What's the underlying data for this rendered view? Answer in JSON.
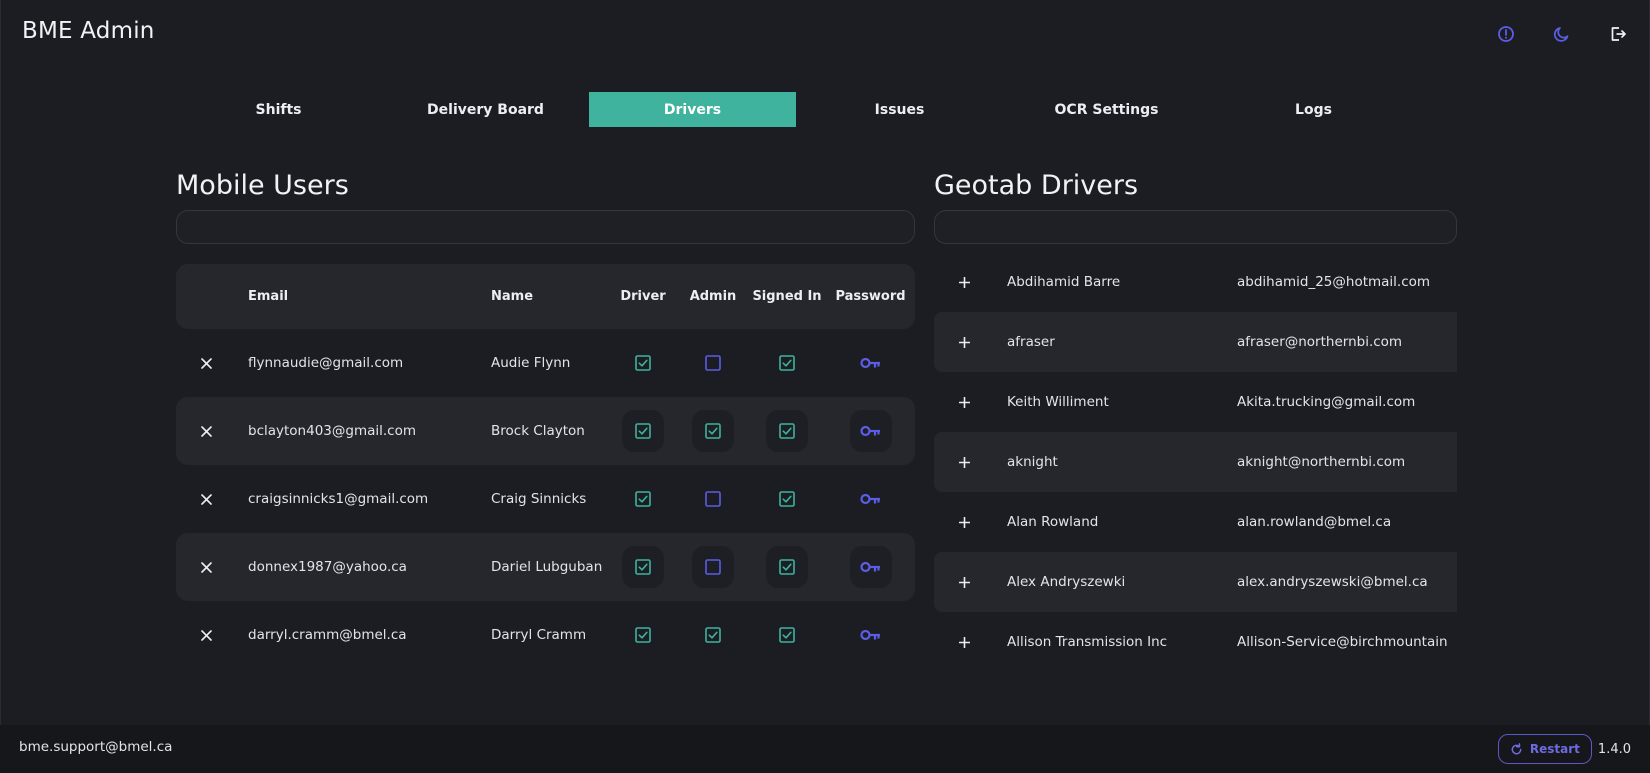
{
  "app": {
    "title": "BME Admin"
  },
  "header_icons": [
    "info-icon",
    "moon-icon",
    "logout-icon"
  ],
  "colors": {
    "accent": "#3fb39d",
    "check": "#3fb39d",
    "admin_unchecked": "#5b5de6",
    "key": "#5b5de6",
    "restart": "#6d6be0"
  },
  "tabs": [
    {
      "label": "Shifts",
      "active": false
    },
    {
      "label": "Delivery Board",
      "active": false
    },
    {
      "label": "Drivers",
      "active": true
    },
    {
      "label": "Issues",
      "active": false
    },
    {
      "label": "OCR Settings",
      "active": false
    },
    {
      "label": "Logs",
      "active": false
    }
  ],
  "mobile_users": {
    "title": "Mobile Users",
    "search": {
      "value": "",
      "placeholder": ""
    },
    "columns": {
      "email": "Email",
      "name": "Name",
      "driver": "Driver",
      "admin": "Admin",
      "signed_in": "Signed In",
      "password": "Password"
    },
    "rows": [
      {
        "email": "flynnaudie@gmail.com",
        "name": "Audie Flynn",
        "driver": true,
        "admin": false,
        "signed_in": true
      },
      {
        "email": "bclayton403@gmail.com",
        "name": "Brock Clayton",
        "driver": true,
        "admin": true,
        "signed_in": true
      },
      {
        "email": "craigsinnicks1@gmail.com",
        "name": "Craig Sinnicks",
        "driver": true,
        "admin": false,
        "signed_in": true
      },
      {
        "email": "donnex1987@yahoo.ca",
        "name": "Dariel Lubguban",
        "driver": true,
        "admin": false,
        "signed_in": true
      },
      {
        "email": "darryl.cramm@bmel.ca",
        "name": "Darryl Cramm",
        "driver": true,
        "admin": true,
        "signed_in": true
      }
    ]
  },
  "geotab_drivers": {
    "title": "Geotab Drivers",
    "search": {
      "value": "",
      "placeholder": ""
    },
    "rows": [
      {
        "name": "Abdihamid Barre",
        "email": "abdihamid_25@hotmail.com"
      },
      {
        "name": "afraser",
        "email": "afraser@northernbi.com"
      },
      {
        "name": "Keith Williment",
        "email": "Akita.trucking@gmail.com"
      },
      {
        "name": "aknight",
        "email": "aknight@northernbi.com"
      },
      {
        "name": "Alan Rowland",
        "email": "alan.rowland@bmel.ca"
      },
      {
        "name": "Alex Andryszewki",
        "email": "alex.andryszewski@bmel.ca"
      },
      {
        "name": "Allison Transmission Inc",
        "email": "Allison-Service@birchmountain"
      }
    ]
  },
  "footer": {
    "email": "bme.support@bmel.ca",
    "restart_label": "Restart",
    "version": "1.4.0"
  }
}
